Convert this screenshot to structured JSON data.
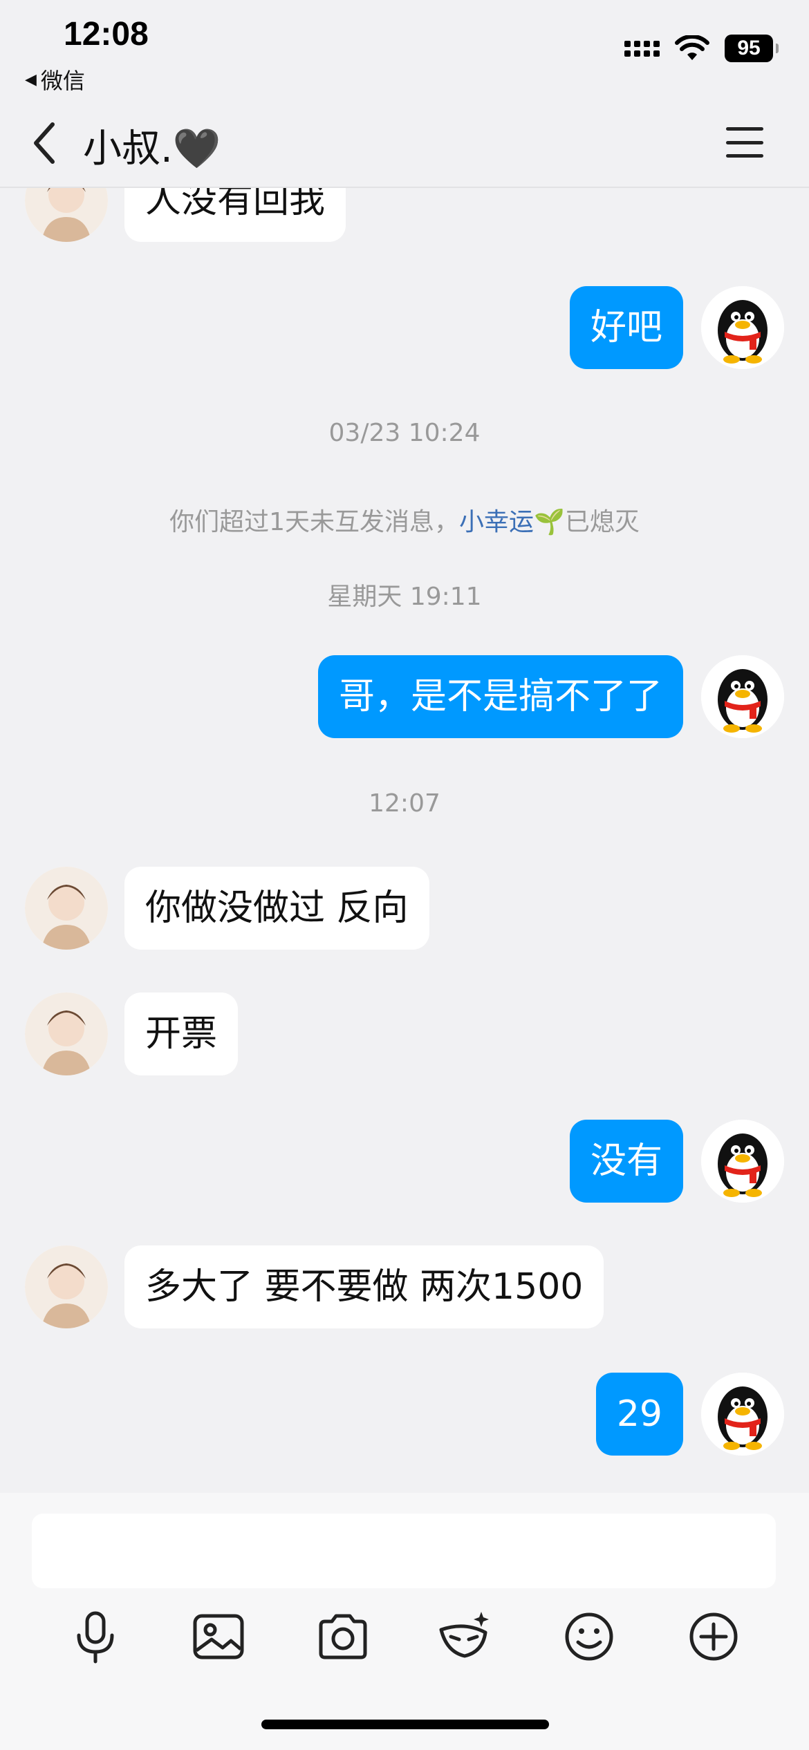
{
  "status": {
    "time": "12:08",
    "back_app": "微信",
    "battery": "95"
  },
  "nav": {
    "title": "小叔.🖤"
  },
  "messages": {
    "m1": "人没有回我",
    "m2": "好吧",
    "ts1": "03/23 10:24",
    "sys_prefix": "你们超过1天未互发消息，",
    "sys_link": "小幸运",
    "sys_emoji": "🌱",
    "sys_suffix": "已熄灭",
    "ts2": "星期天 19:11",
    "m3": "哥，是不是搞不了了",
    "ts3": "12:07",
    "m4": "你做没做过 反向",
    "m5": "开票",
    "m6": "没有",
    "m7": "多大了 要不要做 两次1500",
    "m8": "29"
  },
  "colors": {
    "accent": "#0099ff",
    "background": "#f1f1f3",
    "link": "#3b6fb6"
  },
  "toolbar": [
    "microphone-icon",
    "image-icon",
    "camera-icon",
    "face-mask-icon",
    "emoji-icon",
    "plus-icon"
  ]
}
